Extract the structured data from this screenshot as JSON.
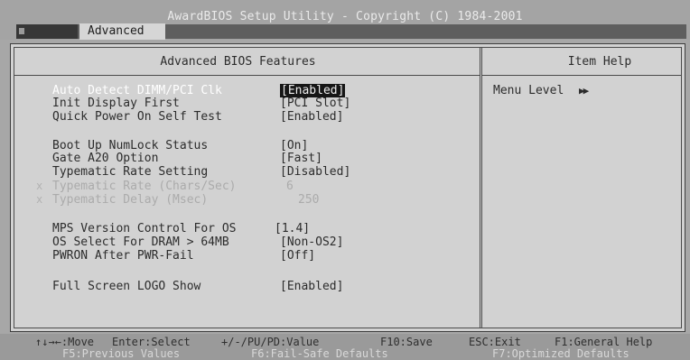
{
  "window": {
    "title": "AwardBIOS Setup Utility - Copyright (C) 1984-2001",
    "active_tab": "Advanced"
  },
  "panel": {
    "title": "Advanced BIOS Features",
    "help_title": "Item Help"
  },
  "options": [
    {
      "label": "Auto Detect DIMM/PCI Clk",
      "value": "[Enabled]",
      "state": "selected"
    },
    {
      "label": "Init Display First",
      "value": "[PCI Slot]",
      "state": "normal"
    },
    {
      "label": "Quick Power On Self Test",
      "value": "[Enabled]",
      "state": "normal"
    },
    {
      "label": "Boot Up NumLock Status",
      "value": "[On]",
      "state": "normal"
    },
    {
      "label": "Gate A20 Option",
      "value": "[Fast]",
      "state": "normal"
    },
    {
      "label": "Typematic Rate Setting",
      "value": "[Disabled]",
      "state": "normal"
    },
    {
      "label": "Typematic Rate (Chars/Sec)",
      "value": "6",
      "state": "disabled"
    },
    {
      "label": "Typematic Delay (Msec)",
      "value": "250",
      "state": "disabled"
    },
    {
      "label": "MPS Version Control For OS",
      "value": "[1.4]",
      "state": "normal"
    },
    {
      "label": "OS Select For DRAM > 64MB",
      "value": "[Non-OS2]",
      "state": "normal"
    },
    {
      "label": "PWRON After PWR-Fail",
      "value": "[Off]",
      "state": "normal"
    },
    {
      "label": "Full Screen LOGO Show",
      "value": "[Enabled]",
      "state": "normal"
    }
  ],
  "disabled_marker": "x",
  "help": {
    "menu_level_label": "Menu Level",
    "menu_level_arrows": "▶▶"
  },
  "footer": {
    "row1": {
      "move": "↑↓→←:Move",
      "select": "Enter:Select",
      "value": "+/-/PU/PD:Value",
      "save": "F10:Save",
      "exit": "ESC:Exit",
      "help": "F1:General Help"
    },
    "row2": {
      "previous": "F5:Previous Values",
      "failsafe": "F6:Fail-Safe Defaults",
      "optimized": "F7:Optimized Defaults"
    }
  }
}
